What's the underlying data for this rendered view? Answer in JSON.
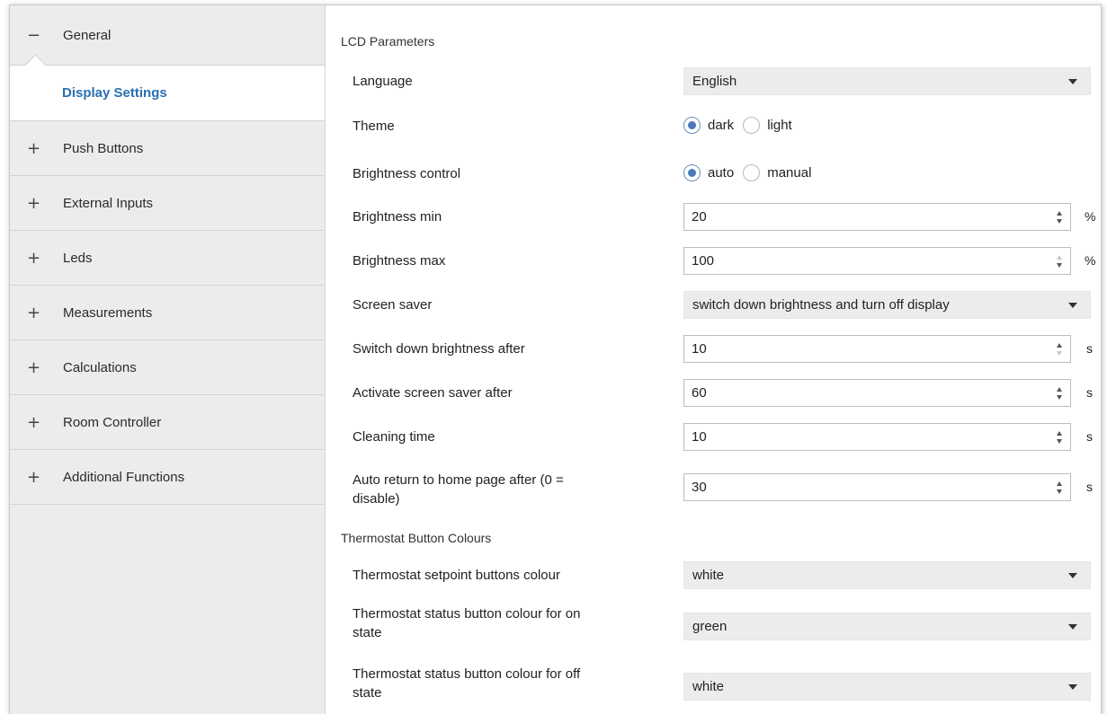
{
  "sidebar": {
    "general": {
      "sign": "−",
      "label": "General"
    },
    "display_settings": "Display Settings",
    "items": [
      {
        "sign": "+",
        "label": "Push Buttons"
      },
      {
        "sign": "+",
        "label": "External Inputs"
      },
      {
        "sign": "+",
        "label": "Leds"
      },
      {
        "sign": "+",
        "label": "Measurements"
      },
      {
        "sign": "+",
        "label": "Calculations"
      },
      {
        "sign": "+",
        "label": "Room Controller"
      },
      {
        "sign": "+",
        "label": "Additional Functions"
      }
    ]
  },
  "lcd": {
    "title": "LCD Parameters",
    "language": {
      "label": "Language",
      "value": "English"
    },
    "theme": {
      "label": "Theme",
      "options": [
        "dark",
        "light"
      ],
      "selected": "dark"
    },
    "brightness_control": {
      "label": "Brightness control",
      "options": [
        "auto",
        "manual"
      ],
      "selected": "auto"
    },
    "brightness_min": {
      "label": "Brightness min",
      "value": "20",
      "unit": "%"
    },
    "brightness_max": {
      "label": "Brightness max",
      "value": "100",
      "unit": "%"
    },
    "screen_saver": {
      "label": "Screen saver",
      "value": "switch down brightness and turn off display"
    },
    "switch_down": {
      "label": "Switch down brightness after",
      "value": "10",
      "unit": "s"
    },
    "activate_saver": {
      "label": "Activate screen saver after",
      "value": "60",
      "unit": "s"
    },
    "cleaning": {
      "label": "Cleaning time",
      "value": "10",
      "unit": "s"
    },
    "auto_return": {
      "label_line1": "Auto return to home page after (0 =",
      "label_line2": "disable)",
      "value": "30",
      "unit": "s"
    }
  },
  "thermostat": {
    "title": "Thermostat Button Colours",
    "setpoint": {
      "label": "Thermostat setpoint buttons colour",
      "value": "white"
    },
    "on_state": {
      "label_line1": "Thermostat status button colour for on",
      "label_line2": "state",
      "value": "green"
    },
    "off_state": {
      "label_line1": "Thermostat status button colour for off",
      "label_line2": "state",
      "value": "white"
    }
  },
  "colors": {
    "accent": "#2a6fb2",
    "radio_selected": "#4a78b8",
    "sidebar_bg": "#ececec"
  }
}
